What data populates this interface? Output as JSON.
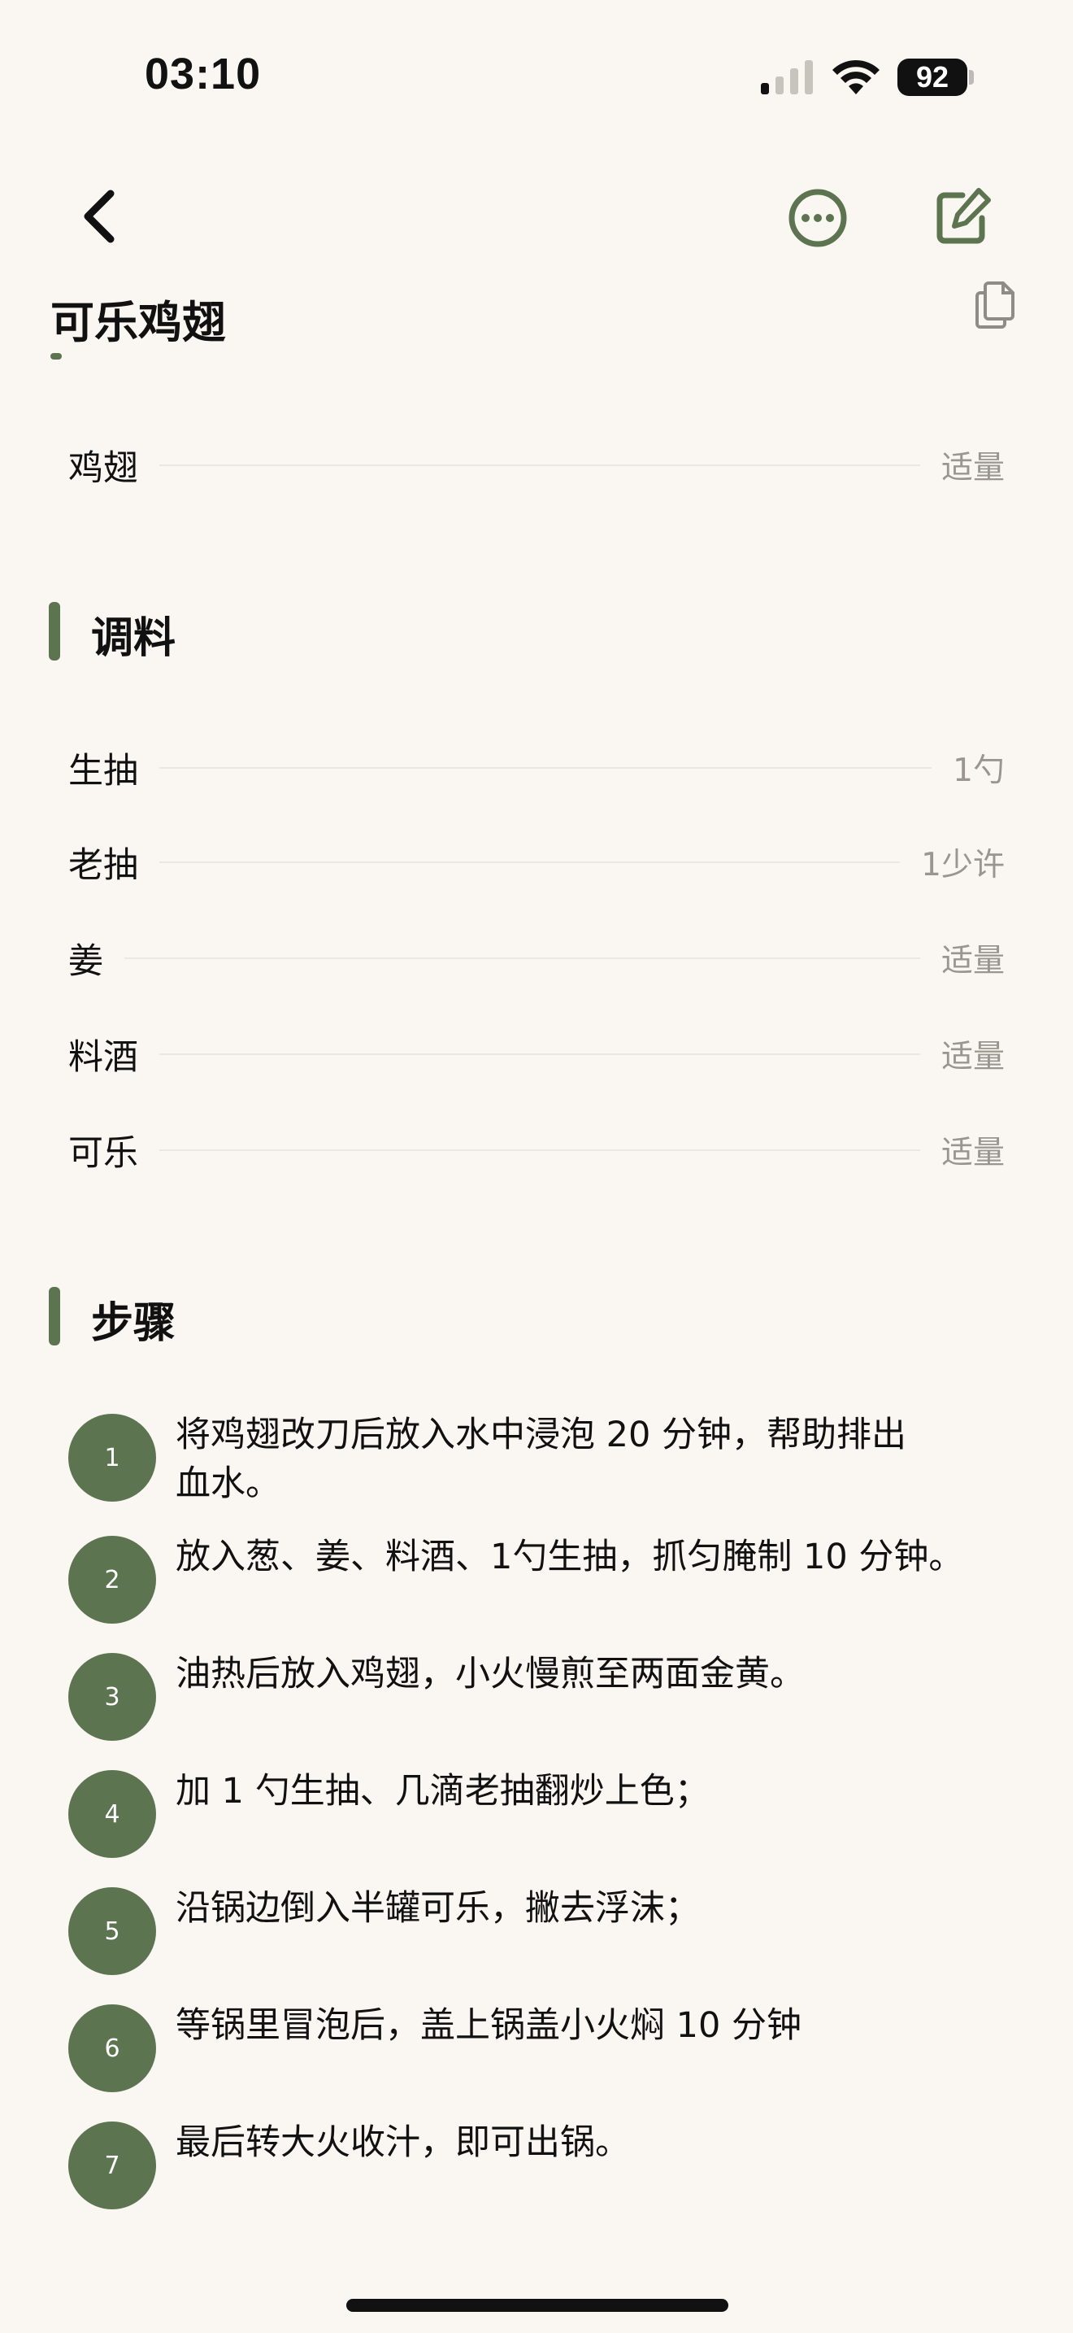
{
  "status_bar": {
    "time": "03:10",
    "battery": "92"
  },
  "nav": {
    "back_icon": "chevron-left-icon",
    "more_icon": "ellipsis-circle-icon",
    "edit_icon": "square-pencil-icon",
    "copy_icon": "copy-document-icon"
  },
  "recipe": {
    "title": "可乐鸡翅"
  },
  "main_ingredients": [
    {
      "name": "鸡翅",
      "amount": "适量"
    }
  ],
  "seasonings": {
    "title": "调料",
    "items": [
      {
        "name": "生抽",
        "amount": "1勺"
      },
      {
        "name": "老抽",
        "amount": "1少许"
      },
      {
        "name": "姜",
        "amount": "适量"
      },
      {
        "name": "料酒",
        "amount": "适量"
      },
      {
        "name": "可乐",
        "amount": "适量"
      }
    ]
  },
  "steps": {
    "title": "步骤",
    "items": [
      {
        "num": "1",
        "text": "将鸡翅改刀后放入水中浸泡 20 分钟，帮助排出血水。"
      },
      {
        "num": "2",
        "text": "放入葱、姜、料酒、1勺生抽，抓匀腌制 10 分钟。"
      },
      {
        "num": "3",
        "text": "油热后放入鸡翅，小火慢煎至两面金黄。"
      },
      {
        "num": "4",
        "text": "加 1 勺生抽、几滴老抽翻炒上色；"
      },
      {
        "num": "5",
        "text": "沿锅边倒入半罐可乐，撇去浮沫；"
      },
      {
        "num": "6",
        "text": "等锅里冒泡后，盖上锅盖小火焖 10 分钟"
      },
      {
        "num": "7",
        "text": "最后转大火收汁，即可出锅。"
      }
    ]
  },
  "colors": {
    "accent": "#5c7550",
    "background": "#faf6f1",
    "muted_text": "#9a9590"
  }
}
